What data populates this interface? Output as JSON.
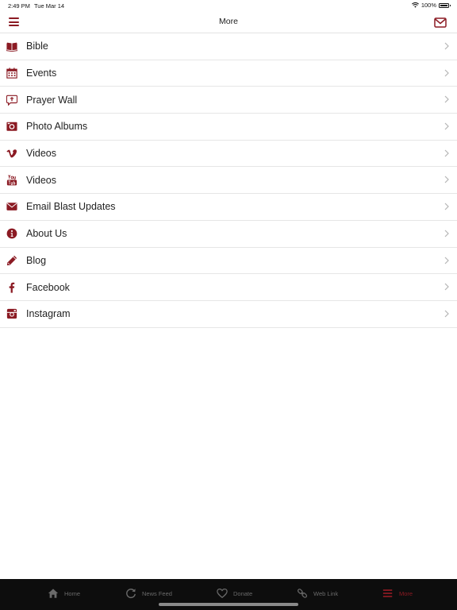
{
  "status": {
    "time": "2:49 PM",
    "date": "Tue Mar 14",
    "battery": "100%"
  },
  "header": {
    "title": "More"
  },
  "colors": {
    "accent": "#8b1a23",
    "tab_bar_bg": "#0d0d0d",
    "tab_inactive": "#6a6a6a"
  },
  "items": [
    {
      "label": "Bible",
      "icon": "bible-icon"
    },
    {
      "label": "Events",
      "icon": "calendar-icon"
    },
    {
      "label": "Prayer Wall",
      "icon": "prayer-bubble-icon"
    },
    {
      "label": "Photo Albums",
      "icon": "camera-icon"
    },
    {
      "label": "Videos",
      "icon": "vimeo-icon"
    },
    {
      "label": "Videos",
      "icon": "youtube-icon"
    },
    {
      "label": "Email Blast Updates",
      "icon": "envelope-icon"
    },
    {
      "label": "About Us",
      "icon": "info-icon"
    },
    {
      "label": "Blog",
      "icon": "pencil-icon"
    },
    {
      "label": "Facebook",
      "icon": "facebook-icon"
    },
    {
      "label": "Instagram",
      "icon": "instagram-icon"
    }
  ],
  "tabs": [
    {
      "label": "Home",
      "icon": "home-icon"
    },
    {
      "label": "News Feed",
      "icon": "refresh-icon"
    },
    {
      "label": "Donate",
      "icon": "heart-icon"
    },
    {
      "label": "Web Link",
      "icon": "link-icon"
    },
    {
      "label": "More",
      "icon": "menu-icon",
      "active": true
    }
  ]
}
